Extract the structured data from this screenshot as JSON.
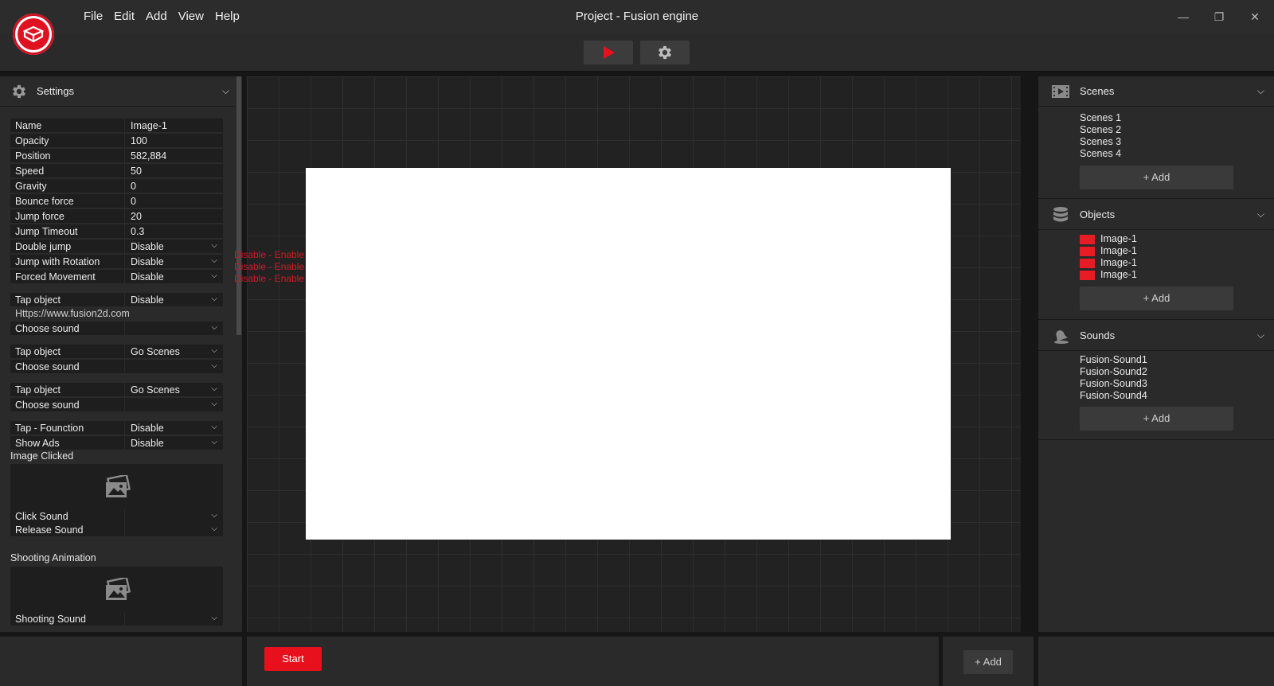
{
  "app": {
    "title": "Project - Fusion engine",
    "menu": [
      "File",
      "Edit",
      "Add",
      "View",
      "Help"
    ],
    "window_controls": {
      "minimize": "—",
      "maximize": "❐",
      "close": "✕"
    },
    "accent_color": "#e8101c"
  },
  "settings_panel": {
    "title": "Settings",
    "properties": [
      {
        "key": "Name",
        "value": "Image-1"
      },
      {
        "key": "Opacity",
        "value": "100"
      },
      {
        "key": "Position",
        "value": "582,884"
      },
      {
        "key": "Speed",
        "value": "50"
      },
      {
        "key": "Gravity",
        "value": "0"
      },
      {
        "key": "Bounce force",
        "value": "0"
      },
      {
        "key": "Jump force",
        "value": "20"
      },
      {
        "key": "Jump Timeout",
        "value": "0.3"
      },
      {
        "key": "Double jump",
        "value": "Disable"
      },
      {
        "key": "Jump with Rotation",
        "value": "Disable"
      },
      {
        "key": "Forced Movement",
        "value": "Disable"
      }
    ],
    "group1": {
      "tap_label": "Tap object",
      "tap_value": "Disable",
      "url": "Https://www.fusion2d.com",
      "sound_label": "Choose sound",
      "sound_value": ""
    },
    "group2": {
      "tap_label": "Tap object",
      "tap_value": "Go Scenes",
      "sound_label": "Choose sound",
      "sound_value": ""
    },
    "group3": {
      "tap_label": "Tap object",
      "tap_value": "Go Scenes",
      "sound_label": "Choose sound",
      "sound_value": ""
    },
    "group4": {
      "func_label": "Tap - Founction",
      "func_value": "Disable",
      "ads_label": "Show Ads",
      "ads_value": "Disable"
    },
    "image_clicked": {
      "label": "Image Clicked",
      "click_sound": "Click Sound",
      "release_sound": "Release Sound"
    },
    "shooting": {
      "label": "Shooting Animation",
      "shooting_sound": "Shooting Sound"
    }
  },
  "canvas": {
    "notes": [
      "Disable - Enable",
      "Disable - Enable",
      "Disable - Enable"
    ]
  },
  "right_panel": {
    "scenes": {
      "title": "Scenes",
      "items": [
        "Scenes 1",
        "Scenes 2",
        "Scenes 3",
        "Scenes 4"
      ],
      "add_label": "Add"
    },
    "objects": {
      "title": "Objects",
      "items": [
        "Image-1",
        "Image-1",
        "Image-1",
        "Image-1"
      ],
      "add_label": "Add"
    },
    "sounds": {
      "title": "Sounds",
      "items": [
        "Fusion-Sound1",
        "Fusion-Sound2",
        "Fusion-Sound3",
        "Fusion-Sound4"
      ],
      "add_label": "Add"
    }
  },
  "bottom": {
    "start_label": "Start",
    "add_label": "Add"
  }
}
